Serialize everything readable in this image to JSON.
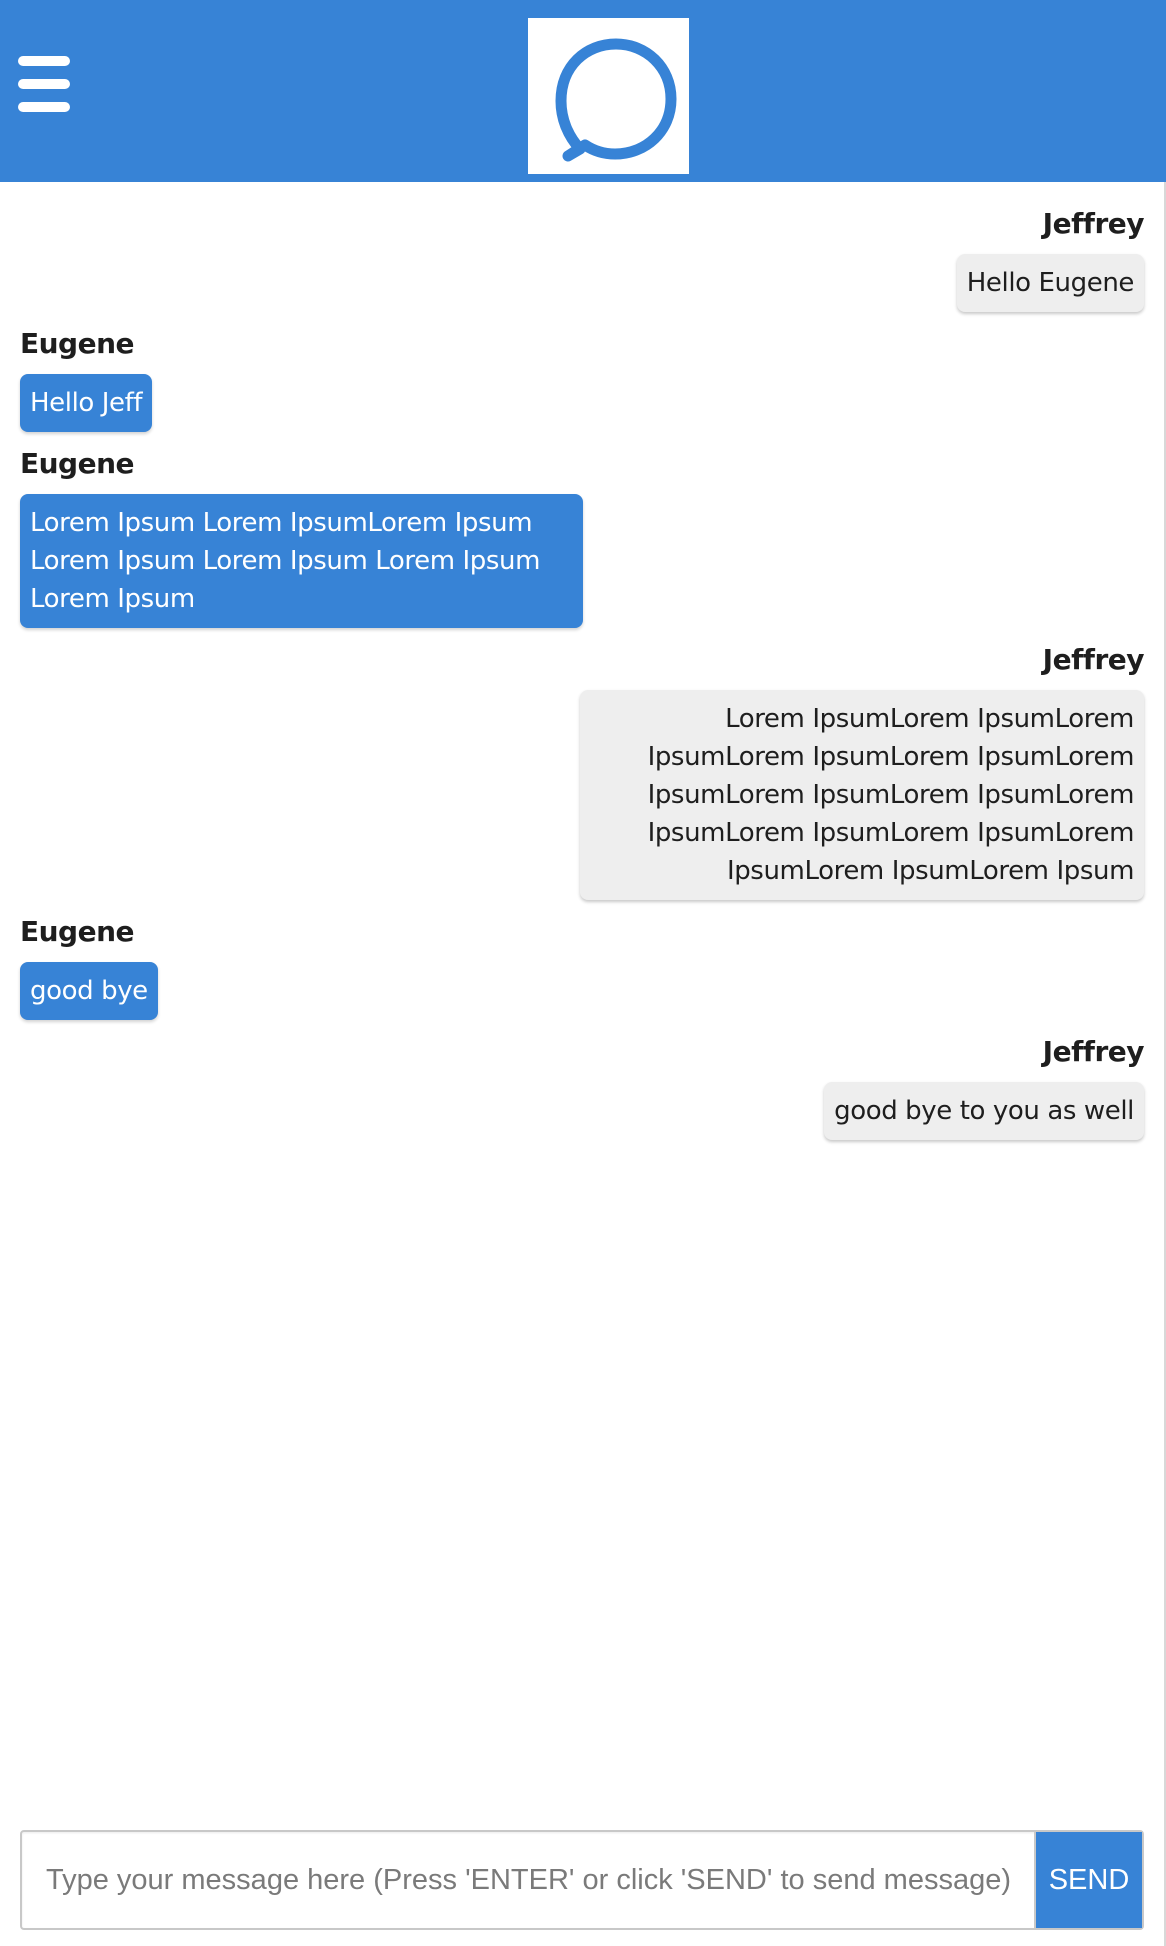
{
  "header": {
    "menu_icon": "hamburger-menu-icon",
    "logo_icon": "chat-bubble-icon",
    "color": "#3783d6"
  },
  "messages": [
    {
      "sender": "Jeffrey",
      "side": "right",
      "text": "Hello Eugene"
    },
    {
      "sender": "Eugene",
      "side": "left",
      "text": "Hello Jeff"
    },
    {
      "sender": "Eugene",
      "side": "left",
      "text": "Lorem Ipsum Lorem IpsumLorem Ipsum Lorem Ipsum Lorem Ipsum Lorem Ipsum Lorem Ipsum"
    },
    {
      "sender": "Jeffrey",
      "side": "right",
      "text": "Lorem IpsumLorem IpsumLorem IpsumLorem IpsumLorem IpsumLorem IpsumLorem IpsumLorem IpsumLorem IpsumLorem IpsumLorem IpsumLorem IpsumLorem IpsumLorem Ipsum"
    },
    {
      "sender": "Eugene",
      "side": "left",
      "text": "good bye"
    },
    {
      "sender": "Jeffrey",
      "side": "right",
      "text": "good bye to you as well"
    }
  ],
  "composer": {
    "placeholder": "Type your message here (Press 'ENTER' or click 'SEND' to send message)",
    "value": "",
    "send_label": "SEND"
  },
  "colors": {
    "accent": "#3783d6",
    "incoming_bubble": "#3783d6",
    "outgoing_bubble": "#eeeeee"
  }
}
